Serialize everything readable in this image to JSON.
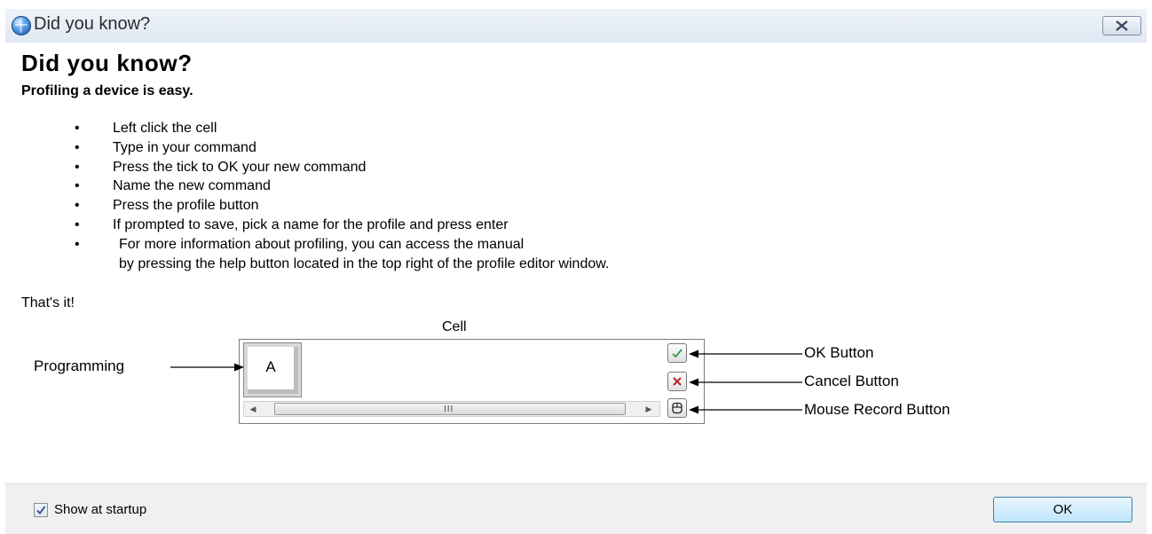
{
  "window": {
    "title": "Did you know?"
  },
  "content": {
    "heading": "Did you know?",
    "subheading": "Profiling a device is easy.",
    "bullet": "•",
    "steps": [
      "Left click the cell",
      "Type in your command",
      "Press the tick to OK your new command",
      "Name the new command",
      "Press the profile button",
      "If prompted to save, pick a name for the profile and press enter",
      "For more information about profiling, you can access the manual",
      "by pressing the help button located in the top right of the profile editor window."
    ],
    "closing": "That's it!"
  },
  "diagram": {
    "cell_label": "Cell",
    "cell_value": "A",
    "programming_label": "Programming",
    "ok_button_label": "OK Button",
    "cancel_button_label": "Cancel Button",
    "mouse_record_label": "Mouse Record Button",
    "scroll_grip": "III",
    "icons": {
      "ok": "check-icon",
      "cancel": "cross-icon",
      "mouse": "mouse-icon"
    },
    "colors": {
      "check": "#2e9b3a",
      "cross": "#b22222"
    }
  },
  "footer": {
    "show_at_startup_label": "Show at startup",
    "show_at_startup_checked": true,
    "ok_label": "OK"
  }
}
